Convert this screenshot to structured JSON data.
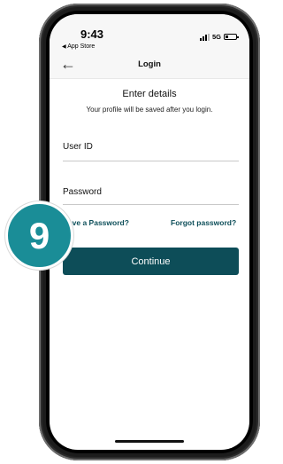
{
  "colors": {
    "accent": "#0d4d58",
    "link": "#0e4f5a",
    "badge": "#1a8d97"
  },
  "status_bar": {
    "time": "9:43",
    "back_app": "App Store",
    "network": "5G",
    "back_app_icon": "triangle-left-icon"
  },
  "nav": {
    "title": "Login",
    "back_icon": "back-arrow-icon"
  },
  "form": {
    "heading": "Enter details",
    "subheading": "Your profile will be saved after you login.",
    "user_id_label": "User ID",
    "password_label": "Password",
    "no_password_link": "Don't have a Password?",
    "forgot_password_link": "Forgot password?",
    "continue_label": "Continue"
  },
  "annotation": {
    "step_number": "9"
  }
}
